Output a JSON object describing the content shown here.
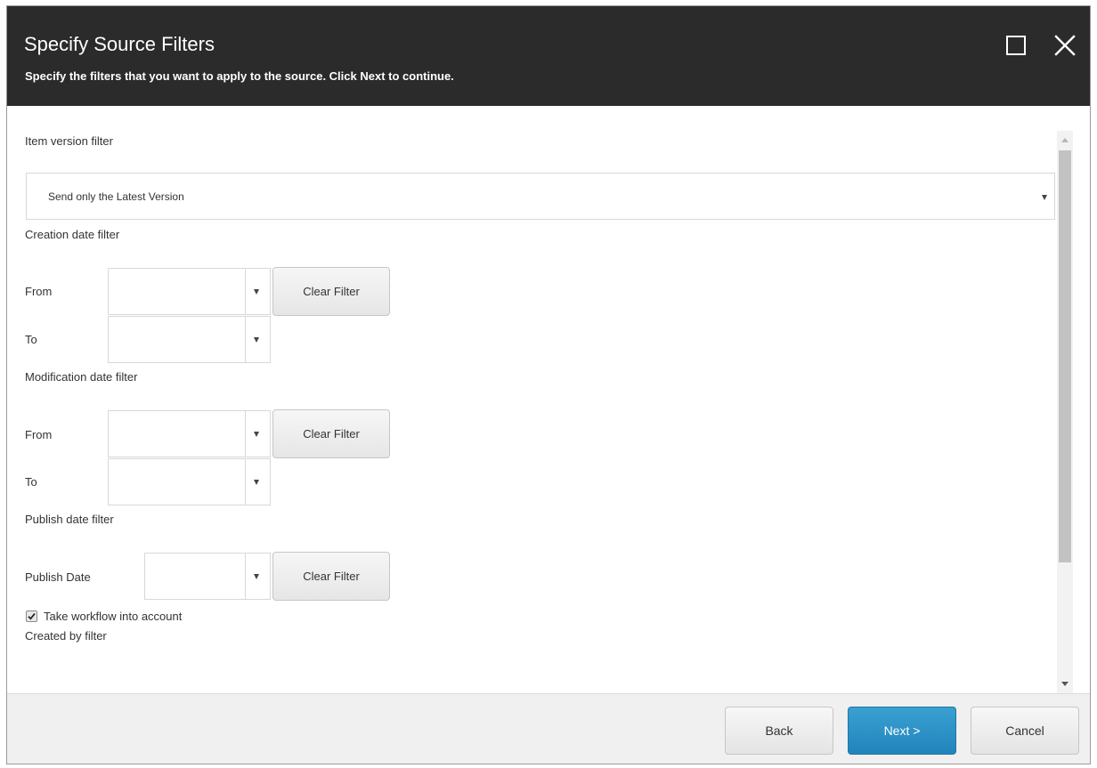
{
  "header": {
    "title": "Specify Source Filters",
    "subtitle": "Specify the filters that you want to apply to the source. Click Next to continue."
  },
  "window_controls": {
    "maximize_icon": "maximize-square-icon",
    "close_icon": "close-x-icon"
  },
  "item_version": {
    "label": "Item version filter",
    "selected": "Send only the Latest Version"
  },
  "creation_date": {
    "label": "Creation date filter",
    "from_label": "From",
    "to_label": "To",
    "from_value": "",
    "to_value": "",
    "clear_label": "Clear Filter"
  },
  "modification_date": {
    "label": "Modification date filter",
    "from_label": "From",
    "to_label": "To",
    "from_value": "",
    "to_value": "",
    "clear_label": "Clear Filter"
  },
  "publish_date": {
    "label": "Publish date filter",
    "date_label": "Publish Date",
    "date_value": "",
    "clear_label": "Clear Filter",
    "workflow_label": "Take workflow into account",
    "workflow_checked": true
  },
  "created_by": {
    "label": "Created by filter"
  },
  "footer": {
    "back_label": "Back",
    "next_label": "Next >",
    "cancel_label": "Cancel"
  },
  "colors": {
    "header_bg": "#2b2b2b",
    "primary_button": "#2a8fc5",
    "footer_bg": "#f0f0f0"
  }
}
